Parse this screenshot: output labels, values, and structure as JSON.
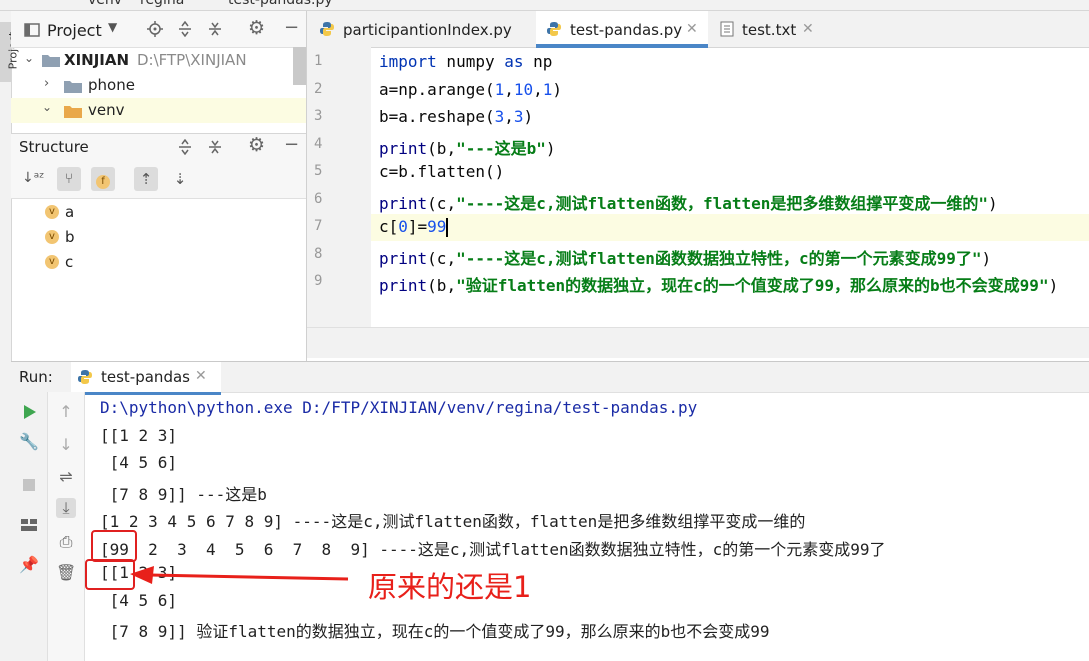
{
  "breadcrumb": {
    "items": [
      "venv",
      "regina",
      "test-pandas.py"
    ]
  },
  "left_strip": {
    "project_tab_label": "Project"
  },
  "project_panel": {
    "title": "Project",
    "root": {
      "name": "XINJIAN",
      "path": "D:\\FTP\\XINJIAN"
    },
    "folders": [
      "phone",
      "venv"
    ]
  },
  "structure_panel": {
    "title": "Structure",
    "items": [
      {
        "badge": "v",
        "name": "a"
      },
      {
        "badge": "v",
        "name": "b"
      },
      {
        "badge": "v",
        "name": "c"
      }
    ]
  },
  "editor": {
    "tabs": [
      {
        "label": "participantionIndex.py",
        "active": false
      },
      {
        "label": "test-pandas.py",
        "active": true
      },
      {
        "label": "test.txt",
        "active": false
      }
    ],
    "line_numbers": [
      "1",
      "2",
      "3",
      "4",
      "5",
      "6",
      "7",
      "8",
      "9"
    ],
    "current_line": 7,
    "code": [
      [
        {
          "t": "kw",
          "s": "import"
        },
        {
          "t": "plain",
          "s": " numpy "
        },
        {
          "t": "kw",
          "s": "as"
        },
        {
          "t": "plain",
          "s": " np"
        }
      ],
      [
        {
          "t": "plain",
          "s": "a=np.arange("
        },
        {
          "t": "num",
          "s": "1"
        },
        {
          "t": "plain",
          "s": ","
        },
        {
          "t": "num",
          "s": "10"
        },
        {
          "t": "plain",
          "s": ","
        },
        {
          "t": "num",
          "s": "1"
        },
        {
          "t": "plain",
          "s": ")"
        }
      ],
      [
        {
          "t": "plain",
          "s": "b=a.reshape("
        },
        {
          "t": "num",
          "s": "3"
        },
        {
          "t": "plain",
          "s": ","
        },
        {
          "t": "num",
          "s": "3"
        },
        {
          "t": "plain",
          "s": ")"
        }
      ],
      [
        {
          "t": "fn",
          "s": "print"
        },
        {
          "t": "plain",
          "s": "(b,"
        },
        {
          "t": "str",
          "s": "\"---这是b\""
        },
        {
          "t": "plain",
          "s": ")"
        }
      ],
      [
        {
          "t": "plain",
          "s": "c=b.flatten()"
        }
      ],
      [
        {
          "t": "fn",
          "s": "print"
        },
        {
          "t": "plain",
          "s": "(c,"
        },
        {
          "t": "str",
          "s": "\"----这是c,测试flatten函数，flatten是把多维数组撑平变成一维的\""
        },
        {
          "t": "plain",
          "s": ")"
        }
      ],
      [
        {
          "t": "plain",
          "s": "c["
        },
        {
          "t": "num",
          "s": "0"
        },
        {
          "t": "plain",
          "s": "]="
        },
        {
          "t": "num",
          "s": "99"
        }
      ],
      [
        {
          "t": "fn",
          "s": "print"
        },
        {
          "t": "plain",
          "s": "(c,"
        },
        {
          "t": "str",
          "s": "\"----这是c,测试flatten函数数据独立特性，c的第一个元素变成99了\""
        },
        {
          "t": "plain",
          "s": ")"
        }
      ],
      [
        {
          "t": "fn",
          "s": "print"
        },
        {
          "t": "plain",
          "s": "(b,"
        },
        {
          "t": "str",
          "s": "\"验证flatten的数据独立，现在c的一个值变成了99，那么原来的b也不会变成99\""
        },
        {
          "t": "plain",
          "s": ")"
        }
      ]
    ]
  },
  "run_panel": {
    "label": "Run:",
    "tab_label": "test-pandas",
    "output": [
      "D:\\python\\python.exe D:/FTP/XINJIAN/venv/regina/test-pandas.py",
      "[[1 2 3]",
      " [4 5 6]",
      " [7 8 9]] ---这是b",
      "[1 2 3 4 5 6 7 8 9] ----这是c,测试flatten函数，flatten是把多维数组撑平变成一维的",
      "[99  2  3  4  5  6  7  8  9] ----这是c,测试flatten函数数据独立特性，c的第一个元素变成99了",
      "[[1 2 3]",
      " [4 5 6]",
      " [7 8 9]] 验证flatten的数据独立，现在c的一个值变成了99，那么原来的b也不会变成99"
    ]
  },
  "annotation": {
    "text": "原来的还是1",
    "color": "#e8201a"
  }
}
